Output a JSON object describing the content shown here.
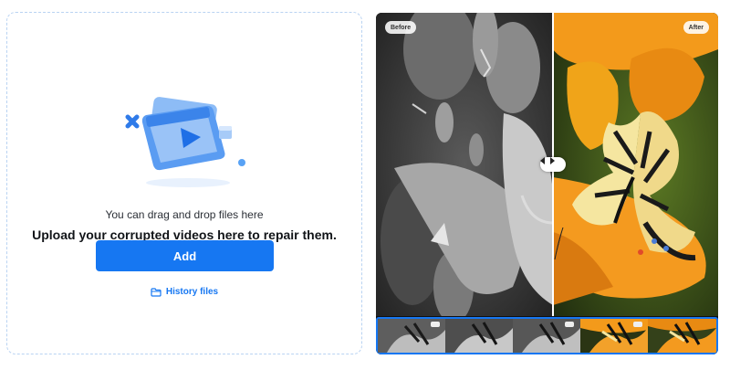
{
  "upload": {
    "drag_hint": "You can drag and drop files here",
    "title": "Upload your corrupted videos here to repair them.",
    "add_button": "Add",
    "history_link": "History files",
    "illustration_icon": "video-file-icon"
  },
  "preview": {
    "before_label": "Before",
    "after_label": "After",
    "divider_icon": "left-right-arrows-icon",
    "filmstrip_frames": 5
  },
  "colors": {
    "accent": "#1677f2",
    "panel_border": "#b9d3f2",
    "flower_orange": "#f39a1b"
  }
}
